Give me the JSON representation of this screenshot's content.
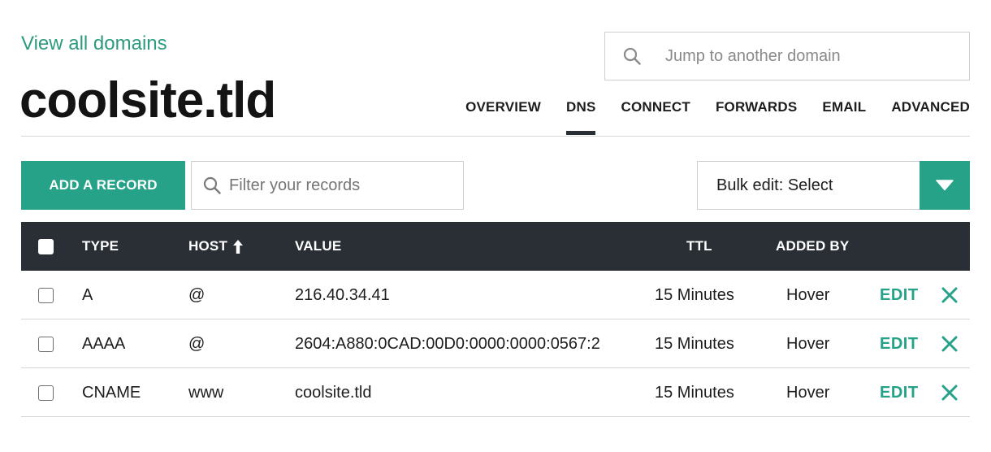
{
  "nav": {
    "back_link": "View all domains"
  },
  "search": {
    "placeholder": "Jump to another domain"
  },
  "domain": {
    "name": "coolsite.tld"
  },
  "tabs": [
    {
      "label": "OVERVIEW",
      "active": false
    },
    {
      "label": "DNS",
      "active": true
    },
    {
      "label": "CONNECT",
      "active": false
    },
    {
      "label": "FORWARDS",
      "active": false
    },
    {
      "label": "EMAIL",
      "active": false
    },
    {
      "label": "ADVANCED",
      "active": false
    }
  ],
  "toolbar": {
    "add_label": "ADD A RECORD",
    "filter_placeholder": "Filter your records",
    "bulk_label": "Bulk edit: Select"
  },
  "table": {
    "headers": {
      "type": "TYPE",
      "host": "HOST",
      "value": "VALUE",
      "ttl": "TTL",
      "added_by": "ADDED BY"
    },
    "rows": [
      {
        "type": "A",
        "host": "@",
        "value": "216.40.34.41",
        "ttl": "15 Minutes",
        "added_by": "Hover",
        "edit": "EDIT"
      },
      {
        "type": "AAAA",
        "host": "@",
        "value": "2604:A880:0CAD:00D0:0000:0000:0567:2",
        "ttl": "15 Minutes",
        "added_by": "Hover",
        "edit": "EDIT"
      },
      {
        "type": "CNAME",
        "host": "www",
        "value": "coolsite.tld",
        "ttl": "15 Minutes",
        "added_by": "Hover",
        "edit": "EDIT"
      }
    ]
  },
  "colors": {
    "accent": "#25a287",
    "link": "#2e9a7e",
    "header_bg": "#2a2f36"
  },
  "icons": {
    "search": "search-icon",
    "sort": "arrow-up-icon",
    "dropdown": "caret-down-icon",
    "delete": "close-icon"
  }
}
